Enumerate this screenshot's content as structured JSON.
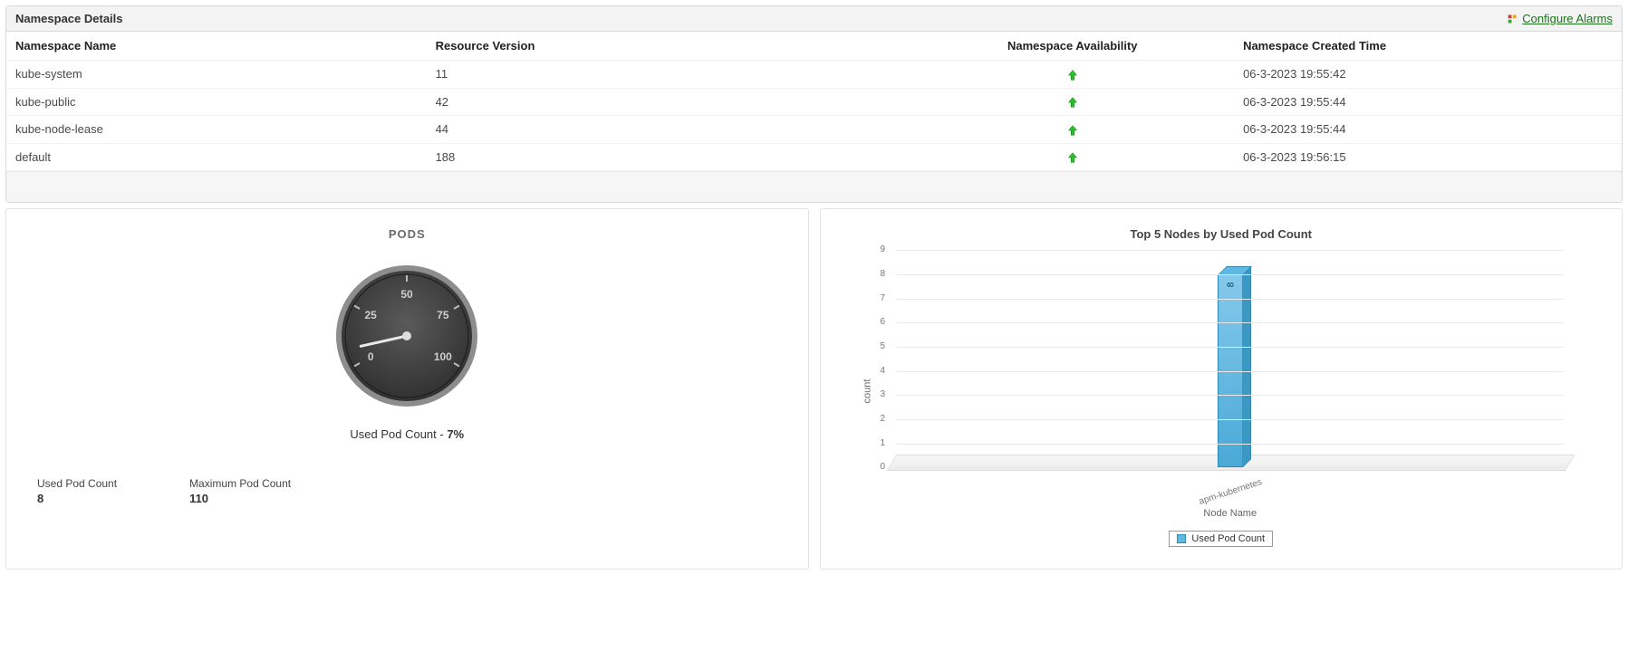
{
  "namespace_panel": {
    "title": "Namespace Details",
    "configure_alarms_label": "Configure Alarms",
    "columns": {
      "name": "Namespace Name",
      "version": "Resource Version",
      "availability": "Namespace Availability",
      "created": "Namespace Created Time"
    },
    "rows": [
      {
        "name": "kube-system",
        "version": "11",
        "availability": "up",
        "created": "06-3-2023 19:55:42"
      },
      {
        "name": "kube-public",
        "version": "42",
        "availability": "up",
        "created": "06-3-2023 19:55:44"
      },
      {
        "name": "kube-node-lease",
        "version": "44",
        "availability": "up",
        "created": "06-3-2023 19:55:44"
      },
      {
        "name": "default",
        "version": "188",
        "availability": "up",
        "created": "06-3-2023 19:56:15"
      }
    ]
  },
  "pods_card": {
    "title": "PODS",
    "gauge": {
      "ticks": [
        "0",
        "25",
        "50",
        "75",
        "100"
      ],
      "min": 0,
      "max": 110,
      "value": 8
    },
    "caption_prefix": "Used Pod Count - ",
    "caption_value": "7%",
    "stats": [
      {
        "label": "Used Pod Count",
        "value": "8"
      },
      {
        "label": "Maximum Pod Count",
        "value": "110"
      }
    ]
  },
  "chart_data": {
    "type": "bar",
    "title": "Top 5 Nodes by Used Pod Count",
    "xlabel": "Node Name",
    "ylabel": "count",
    "ylim": [
      0,
      9
    ],
    "y_ticks": [
      0,
      1,
      2,
      3,
      4,
      5,
      6,
      7,
      8,
      9
    ],
    "categories": [
      "apm-kubernetes"
    ],
    "values": [
      8
    ],
    "legend": "Used Pod Count",
    "series_color": "#5fb7e4"
  }
}
